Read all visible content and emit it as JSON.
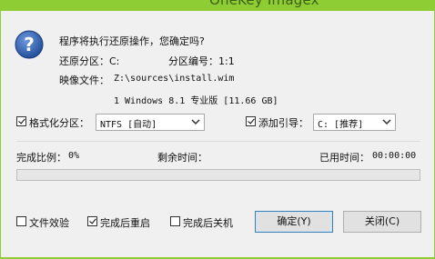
{
  "window": {
    "title": "OneKey Imagex"
  },
  "message": {
    "question": "程序将执行还原操作，您确定吗?",
    "restore_partition_label": "还原分区：C:",
    "partition_number_label": "分区编号：1:1",
    "image_file_label": "映像文件：",
    "image_file_path": "Z:\\sources\\install.wim",
    "image_info": "1 Windows 8.1 专业版 [11.66 GB]"
  },
  "options": {
    "format_label": "格式化分区：",
    "format_checked": true,
    "format_select_value": "NTFS [自动]",
    "boot_label": "添加引导：",
    "boot_checked": true,
    "boot_select_value": "C: [推荐]"
  },
  "status": {
    "progress_label": "完成比例：",
    "progress_value": "0%",
    "progress_fraction": 0,
    "remaining_label": "剩余时间：",
    "remaining_value": "",
    "elapsed_label": "已用时间：",
    "elapsed_value": "00:00:00"
  },
  "footer": {
    "verify_label": "文件效验",
    "verify_checked": false,
    "reboot_label": "完成后重启",
    "reboot_checked": true,
    "shutdown_label": "完成后关机",
    "shutdown_checked": false,
    "ok_button": "确定(Y)",
    "close_button": "关闭(C)"
  },
  "colors": {
    "titlebar": "#8fcd35",
    "progress_fill": "#06b025",
    "question_icon": "#2e5ea8"
  }
}
